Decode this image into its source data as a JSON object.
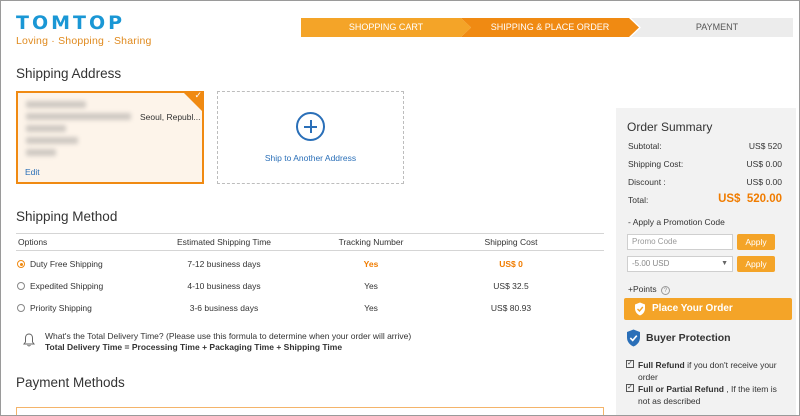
{
  "brand": {
    "name": "TOMTOP",
    "tagline": "Loving · Shopping · Sharing"
  },
  "steps": [
    "SHOPPING CART",
    "SHIPPING & PLACE ORDER",
    "PAYMENT"
  ],
  "shipping_address": {
    "title": "Shipping Address",
    "selected_city": "Seoul, Republ...",
    "edit_label": "Edit",
    "add_label": "Ship to Another Address"
  },
  "shipping_method": {
    "title": "Shipping Method",
    "headers": [
      "Options",
      "Estimated Shipping Time",
      "Tracking Number",
      "Shipping Cost"
    ],
    "rows": [
      {
        "option": "Duty Free Shipping",
        "time": "7-12 business days",
        "tracking": "Yes",
        "cost": "US$ 0",
        "selected": true
      },
      {
        "option": "Expedited Shipping",
        "time": "4-10 business days",
        "tracking": "Yes",
        "cost": "US$ 32.5",
        "selected": false
      },
      {
        "option": "Priority Shipping",
        "time": "3-6 business days",
        "tracking": "Yes",
        "cost": "US$ 80.93",
        "selected": false
      }
    ],
    "note_question": "What's the Total Delivery Time? (Please use this formula to determine when your order will arrive)",
    "note_formula": "Total Delivery Time = Processing Time + Packaging Time + Shipping Time"
  },
  "payment": {
    "title": "Payment Methods"
  },
  "summary": {
    "title": "Order Summary",
    "subtotal_label": "Subtotal:",
    "subtotal": "US$ 520",
    "shipping_label": "Shipping Cost:",
    "shipping": "US$ 0.00",
    "discount_label": "Discount :",
    "discount": "US$ 0.00",
    "total_label": "Total:",
    "total": "US$  520.00",
    "promo_label": "- Apply a Promotion Code",
    "promo_placeholder": "Promo Code",
    "apply_label": "Apply",
    "coupon_value": "-5.00 USD",
    "points_label": "+Points",
    "place_order_label": "Place Your Order",
    "buyer_protection_title": "Buyer Protection",
    "protection_items": [
      {
        "bold": "Full Refund",
        "text": " if you don't receive your order"
      },
      {
        "bold": "Full or Partial Refund",
        "text": " , If the item is not as described"
      }
    ]
  },
  "colors": {
    "brand_blue": "#1a97d5",
    "accent_orange": "#f08a12",
    "button_orange": "#f4a428",
    "link_blue": "#2a6fb8"
  }
}
